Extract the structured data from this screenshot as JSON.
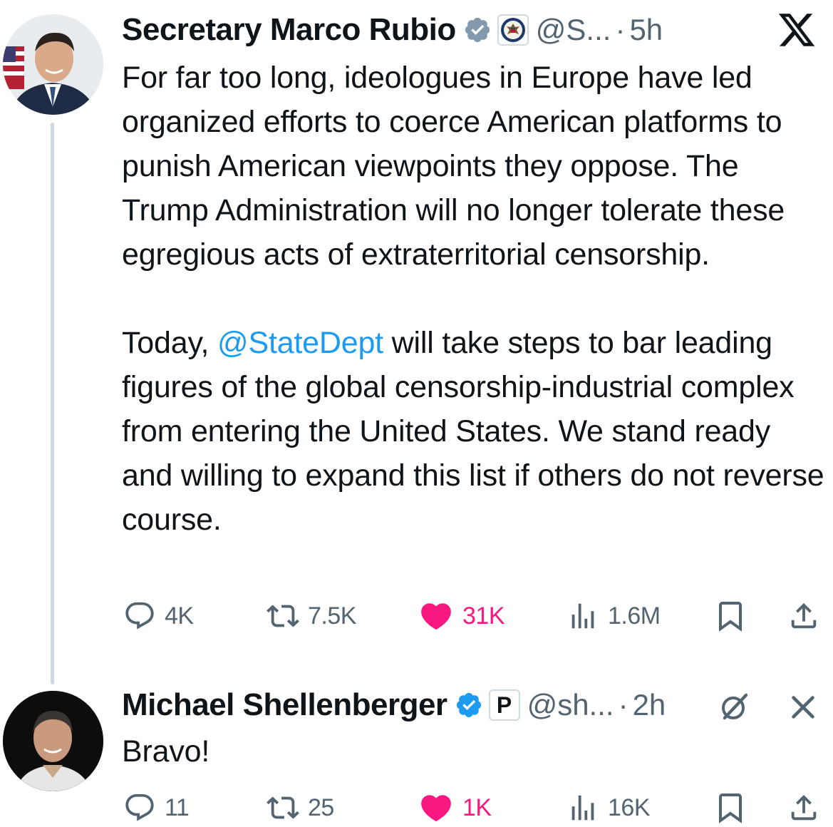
{
  "tweet1": {
    "author_name": "Secretary Marco Rubio",
    "handle": "@S...",
    "separator": "·",
    "time": "5h",
    "paragraph1": "For far too long, ideologues in Europe have led organized efforts to coerce American platforms to punish American viewpoints they oppose. The Trump Administration will no longer tolerate these egregious acts of extraterritorial censorship.",
    "paragraph2_before": "Today, ",
    "mention": "@StateDept",
    "paragraph2_after": " will take steps to bar leading figures of the global censorship-industrial complex from entering the United States. We stand ready and willing to expand this list if others do not reverse course.",
    "replies": "4K",
    "reposts": "7.5K",
    "likes": "31K",
    "views": "1.6M",
    "liked": true
  },
  "tweet2": {
    "author_name": "Michael Shellenberger",
    "affiliate_badge": "P",
    "handle": "@sh...",
    "separator": "·",
    "time": "2h",
    "text": "Bravo!",
    "replies": "11",
    "reposts": "25",
    "likes": "1K",
    "views": "16K",
    "liked": true
  },
  "colors": {
    "text": "#0f1419",
    "secondary": "#536471",
    "link": "#1d9bf0",
    "like": "#f91880",
    "verified_gray": "#829aab",
    "verified_blue": "#1d9bf0",
    "thread_line": "#cfd9de"
  },
  "icons": [
    "x-logo-icon",
    "verified-badge-icon",
    "state-dept-seal-icon",
    "reply-icon",
    "repost-icon",
    "heart-icon",
    "views-icon",
    "bookmark-icon",
    "share-icon",
    "grok-icon",
    "close-icon"
  ]
}
